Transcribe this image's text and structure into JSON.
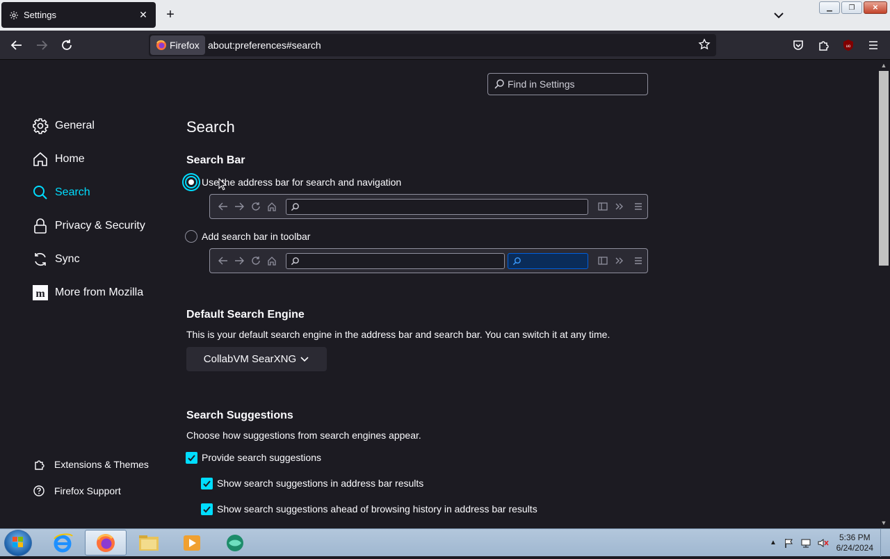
{
  "browser": {
    "tab": {
      "title": "Settings",
      "icon": "gear-icon"
    },
    "identity_label": "Firefox",
    "url": "about:preferences#search"
  },
  "settings": {
    "find_placeholder": "Find in Settings",
    "categories": [
      {
        "label": "General",
        "icon": "gear-icon",
        "selected": false
      },
      {
        "label": "Home",
        "icon": "home-icon",
        "selected": false
      },
      {
        "label": "Search",
        "icon": "search-icon",
        "selected": true
      },
      {
        "label": "Privacy & Security",
        "icon": "lock-icon",
        "selected": false
      },
      {
        "label": "Sync",
        "icon": "sync-icon",
        "selected": false
      },
      {
        "label": "More from Mozilla",
        "icon": "mozilla-icon",
        "selected": false
      }
    ],
    "bottom_links": [
      {
        "label": "Extensions & Themes",
        "icon": "puzzle-icon"
      },
      {
        "label": "Firefox Support",
        "icon": "help-icon"
      }
    ],
    "pane_title": "Search",
    "search_bar": {
      "heading": "Search Bar",
      "option_address_bar": "Use the address bar for search and navigation",
      "option_toolbar": "Add search bar in toolbar",
      "selected": "address_bar"
    },
    "default_engine": {
      "heading": "Default Search Engine",
      "description": "This is your default search engine in the address bar and search bar. You can switch it at any time.",
      "engine": "CollabVM SearXNG"
    },
    "suggestions": {
      "heading": "Search Suggestions",
      "description": "Choose how suggestions from search engines appear.",
      "provide": {
        "label": "Provide search suggestions",
        "checked": true
      },
      "in_address_bar": {
        "label": "Show search suggestions in address bar results",
        "checked": true
      },
      "ahead_of_history": {
        "label": "Show search suggestions ahead of browsing history in address bar results",
        "checked": true
      }
    }
  },
  "taskbar": {
    "time": "5:36 PM",
    "date": "6/24/2024"
  },
  "colors": {
    "accent": "#00ddff",
    "background": "#1c1b22",
    "toolbar": "#2b2a33"
  }
}
